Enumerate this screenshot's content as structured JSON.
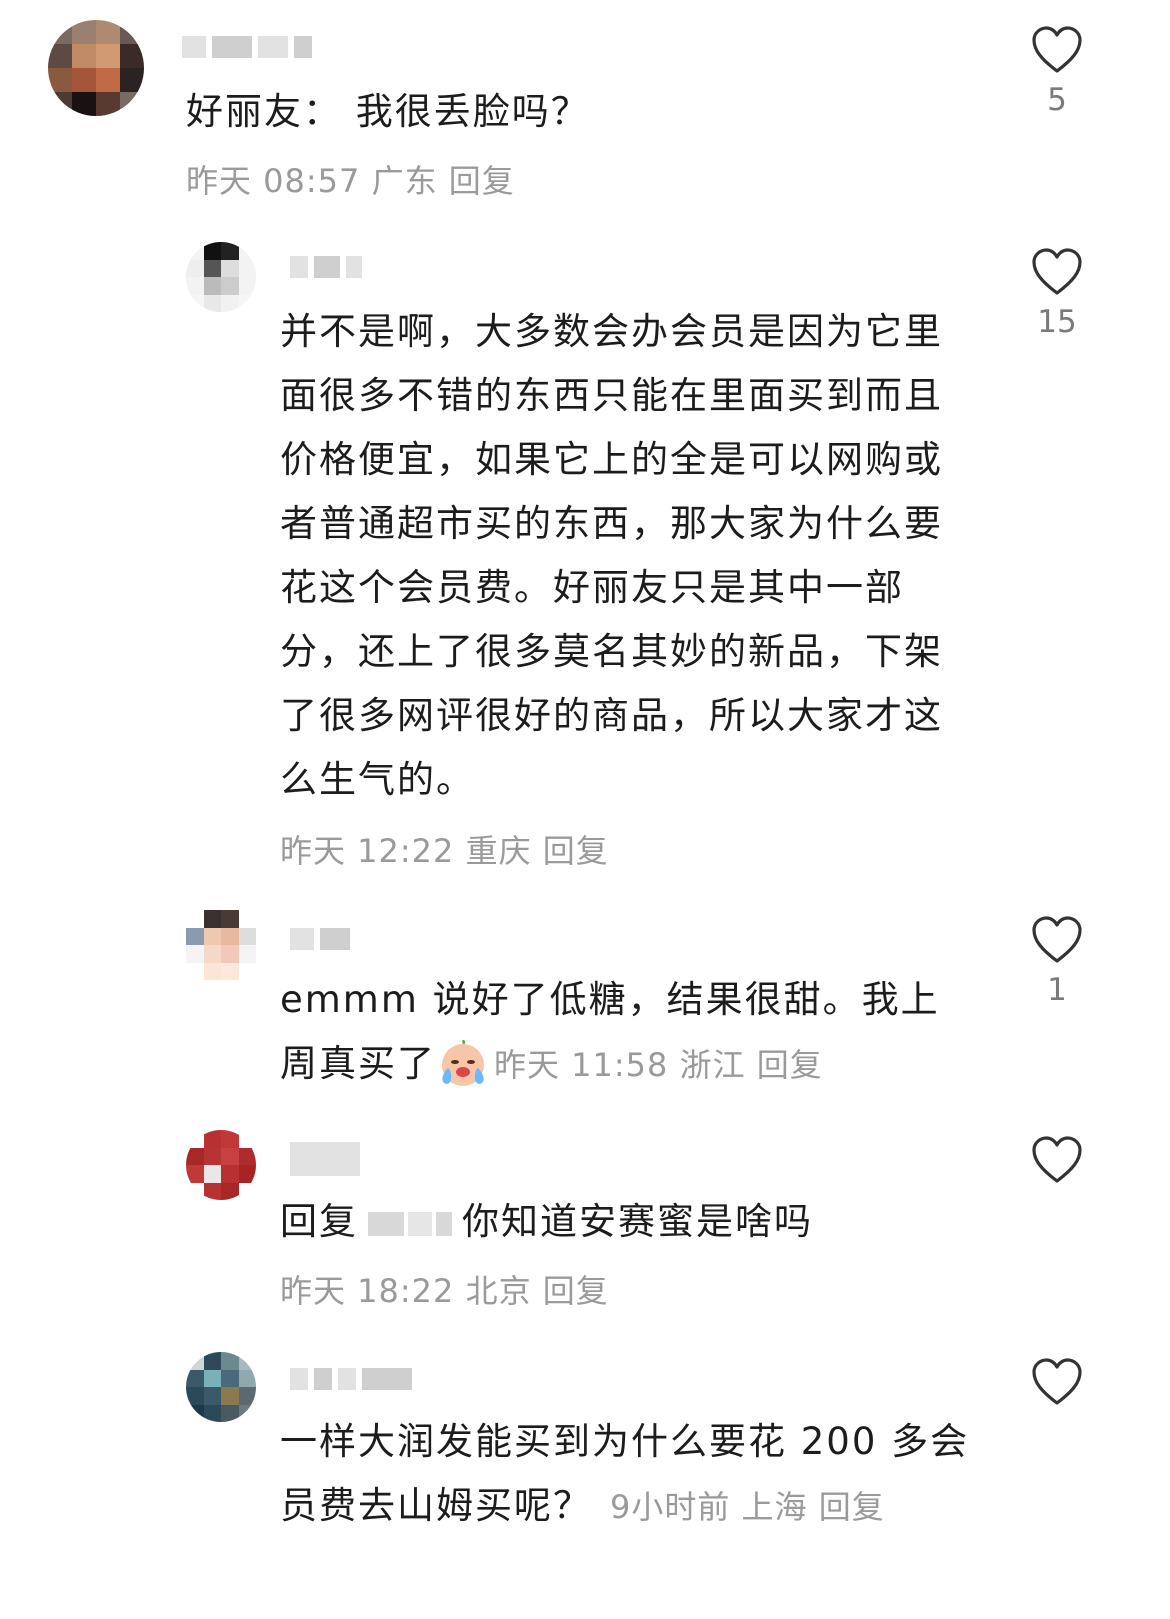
{
  "comments": [
    {
      "text": "好丽友：  我很丢脸吗？",
      "time": "昨天 08:57",
      "location": "广东",
      "reply": "回复",
      "likes": "5"
    },
    {
      "text": "并不是啊，大多数会办会员是因为它里面很多不错的东西只能在里面买到而且价格便宜，如果它上的全是可以网购或者普通超市买的东西，那大家为什么要花这个会员费。好丽友只是其中一部分，还上了很多莫名其妙的新品，下架了很多网评很好的商品，所以大家才这么生气的。",
      "time": "昨天 12:22",
      "location": "重庆",
      "reply": "回复",
      "likes": "15"
    },
    {
      "text": "emmm 说好了低糖，结果很甜。我上周真买了",
      "emoji": "crying-emoji",
      "time": "昨天 11:58",
      "location": "浙江",
      "reply": "回复",
      "likes": "1"
    },
    {
      "reply_prefix": "回复",
      "text": "你知道安赛蜜是啥吗",
      "time": "昨天 18:22",
      "location": "北京",
      "reply": "回复",
      "likes": ""
    },
    {
      "text": "一样大润发能买到为什么要花 200 多会员费去山姆买呢？",
      "time": "9小时前",
      "location": "上海",
      "reply": "回复",
      "likes": ""
    }
  ],
  "icons": {
    "like": "heart-outline-icon"
  },
  "colors": {
    "meta": "#9a9a9a",
    "text": "#1c1c1c",
    "heart": "#333333"
  }
}
